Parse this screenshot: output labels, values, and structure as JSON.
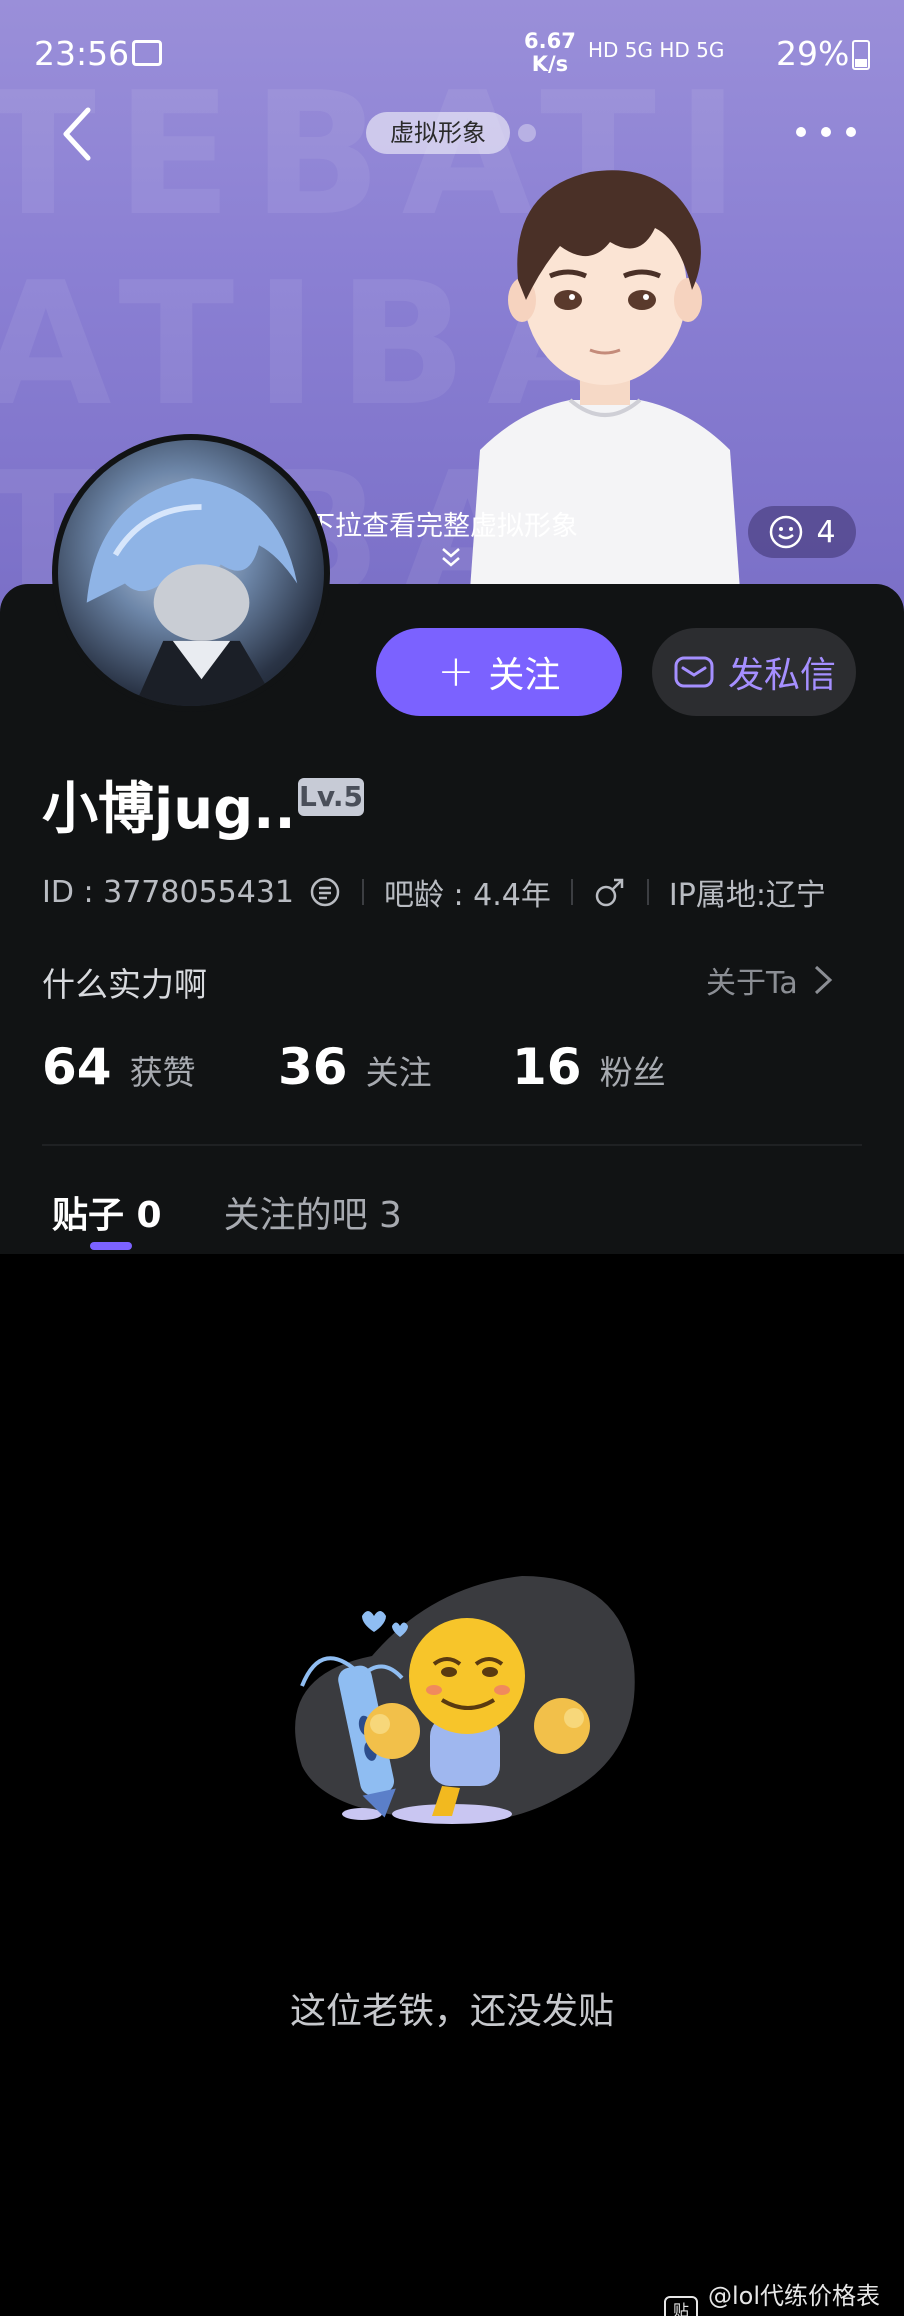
{
  "status_bar": {
    "time": "23:56",
    "net_speed_value": "6.67",
    "net_speed_unit": "K/s",
    "icons_text": "HD 5G HD 5G",
    "battery": "29%"
  },
  "header": {
    "avatar_pill_label": "虚拟形象",
    "pull_hint": "下拉查看完整虚拟形象",
    "like_count": "4"
  },
  "profile": {
    "follow_label": "关注",
    "message_label": "发私信",
    "username": "小博jug..",
    "level": "Lv.5",
    "id_text": "ID : 3778055431",
    "bar_age": "吧龄 : 4.4年",
    "ip_location": "IP属地:辽宁",
    "bio": "什么实力啊",
    "about_label": "关于Ta"
  },
  "stats": [
    {
      "value": "64",
      "label": "获赞"
    },
    {
      "value": "36",
      "label": "关注"
    },
    {
      "value": "16",
      "label": "粉丝"
    }
  ],
  "tabs": [
    {
      "label": "贴子 0",
      "active": true
    },
    {
      "label": "关注的吧 3",
      "active": false
    }
  ],
  "empty_state": {
    "message": "这位老铁，还没发贴"
  },
  "footer": {
    "watermark": "@lol代练价格表吧",
    "watermark_logo": "贴"
  },
  "colors": {
    "accent": "#7b62ff",
    "banner": "#8a7fd3",
    "card_bg": "#111314"
  }
}
